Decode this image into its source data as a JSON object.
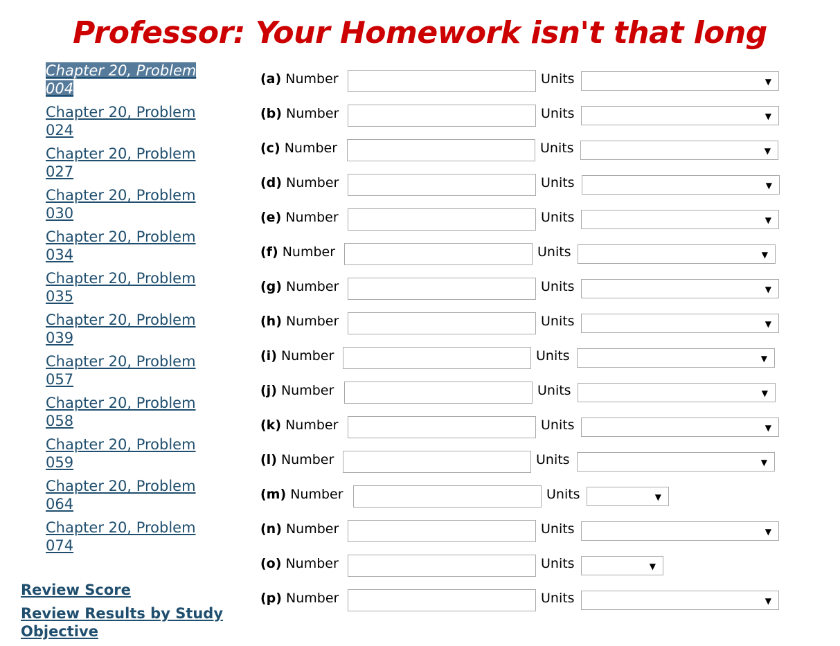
{
  "title": {
    "text": "Professor: Your Homework isn't that long",
    "color": "#cc0000"
  },
  "sidebar": {
    "problems": [
      {
        "label": "Chapter 20, Problem 004",
        "selected": true
      },
      {
        "label": "Chapter 20, Problem 024"
      },
      {
        "label": "Chapter 20, Problem 027"
      },
      {
        "label": "Chapter 20, Problem 030"
      },
      {
        "label": "Chapter 20, Problem 034"
      },
      {
        "label": "Chapter 20, Problem 035"
      },
      {
        "label": "Chapter 20, Problem 039"
      },
      {
        "label": "Chapter 20, Problem 057"
      },
      {
        "label": "Chapter 20, Problem 058"
      },
      {
        "label": "Chapter 20, Problem 059"
      },
      {
        "label": "Chapter 20, Problem 064"
      },
      {
        "label": "Chapter 20, Problem 074"
      }
    ],
    "review_score": "Review Score",
    "review_results": "Review Results by Study Objective"
  },
  "form": {
    "number_label": "Number",
    "units_label": "Units",
    "dropdown_icon": "chevron-down-icon",
    "rows": [
      {
        "part": "(a)",
        "value": "",
        "unit": ""
      },
      {
        "part": "(b)",
        "value": "",
        "unit": ""
      },
      {
        "part": "(c)",
        "value": "",
        "unit": ""
      },
      {
        "part": "(d)",
        "value": "",
        "unit": ""
      },
      {
        "part": "(e)",
        "value": "",
        "unit": ""
      },
      {
        "part": "(f)",
        "value": "",
        "unit": ""
      },
      {
        "part": "(g)",
        "value": "",
        "unit": ""
      },
      {
        "part": "(h)",
        "value": "",
        "unit": ""
      },
      {
        "part": "(i)",
        "value": "",
        "unit": ""
      },
      {
        "part": "(j)",
        "value": "",
        "unit": ""
      },
      {
        "part": "(k)",
        "value": "",
        "unit": ""
      },
      {
        "part": "(l)",
        "value": "",
        "unit": ""
      },
      {
        "part": "(m)",
        "value": "",
        "unit": ""
      },
      {
        "part": "(n)",
        "value": "",
        "unit": ""
      },
      {
        "part": "(o)",
        "value": "",
        "unit": ""
      },
      {
        "part": "(p)",
        "value": "",
        "unit": ""
      }
    ]
  },
  "colors": {
    "link": "#1f4e6e",
    "selected_bg": "#557a9a"
  }
}
